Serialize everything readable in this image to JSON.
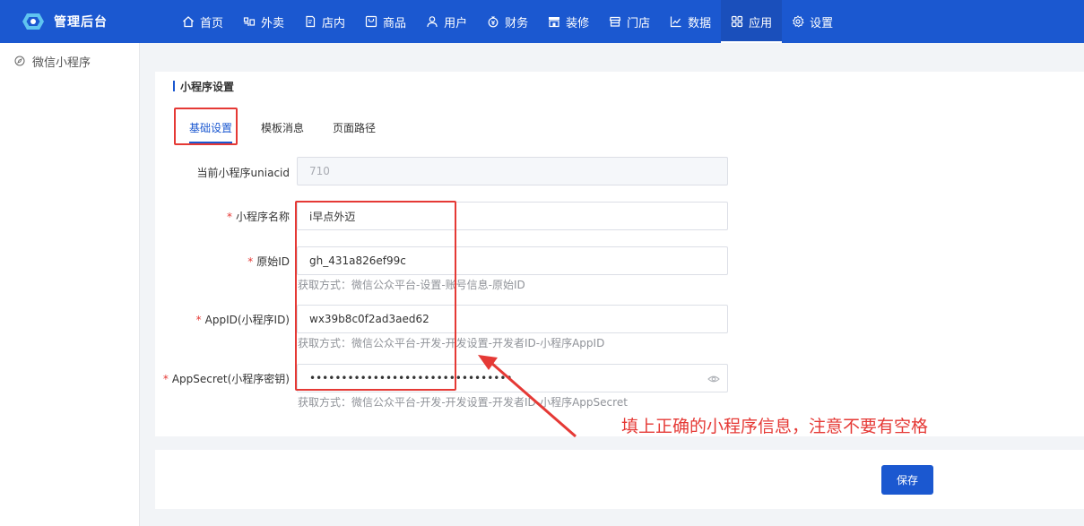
{
  "brand": {
    "title": "管理后台",
    "logo_icon": "cloud-logo-icon",
    "color": "#1b58d0"
  },
  "nav": [
    {
      "label": "首页",
      "icon": "home-icon",
      "active": false
    },
    {
      "label": "外卖",
      "icon": "takeout-icon",
      "active": false
    },
    {
      "label": "店内",
      "icon": "dine-in-icon",
      "active": false
    },
    {
      "label": "商品",
      "icon": "goods-icon",
      "active": false
    },
    {
      "label": "用户",
      "icon": "user-icon",
      "active": false
    },
    {
      "label": "财务",
      "icon": "finance-icon",
      "active": false
    },
    {
      "label": "装修",
      "icon": "decoration-icon",
      "active": false
    },
    {
      "label": "门店",
      "icon": "store-icon",
      "active": false
    },
    {
      "label": "数据",
      "icon": "chart-icon",
      "active": false
    },
    {
      "label": "应用",
      "icon": "apps-icon",
      "active": true
    },
    {
      "label": "设置",
      "icon": "gear-icon",
      "active": false
    }
  ],
  "sidebar": {
    "items": [
      {
        "label": "微信小程序",
        "icon": "compass-icon"
      }
    ]
  },
  "main": {
    "section_title": "小程序设置",
    "tabs": [
      {
        "label": "基础设置",
        "active": true
      },
      {
        "label": "模板消息",
        "active": false
      },
      {
        "label": "页面路径",
        "active": false
      }
    ],
    "form": {
      "uniacid": {
        "label": "当前小程序uniacid",
        "value": "710",
        "required": false,
        "disabled": true
      },
      "name": {
        "label": "小程序名称",
        "value": "i早点外迈",
        "required": true
      },
      "original_id": {
        "label": "原始ID",
        "value": "gh_431a826ef99c",
        "required": true,
        "hint": "获取方式：微信公众平台-设置-账号信息-原始ID"
      },
      "appid": {
        "label": "AppID(小程序ID)",
        "value": "wx39b8c0f2ad3aed62",
        "required": true,
        "hint": "获取方式：微信公众平台-开发-开发设置-开发者ID-小程序AppID"
      },
      "appsecret": {
        "label": "AppSecret(小程序密钥)",
        "value": "••••••••••••••••••••••••••••••••",
        "required": true,
        "hint": "获取方式：微信公众平台-开发-开发设置-开发者ID-小程序AppSecret",
        "icon": "eye-icon"
      }
    }
  },
  "footer": {
    "save_label": "保存"
  },
  "annotation": {
    "text": "填上正确的小程序信息，注意不要有空格",
    "color": "#e53935"
  }
}
